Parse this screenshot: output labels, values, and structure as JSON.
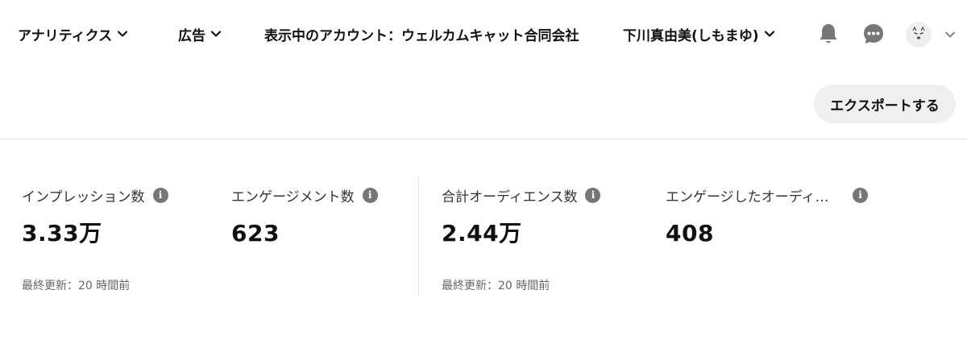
{
  "header": {
    "nav": [
      {
        "label": "アナリティクス"
      },
      {
        "label": "広告"
      }
    ],
    "account_prefix": "表示中のアカウント：",
    "account_name": "ウェルカムキャット合同会社",
    "user_name": "下川真由美(しもまゆ)"
  },
  "toolbar": {
    "export_label": "エクスポートする"
  },
  "metrics": [
    {
      "label": "インプレッション数",
      "value": "3.33万"
    },
    {
      "label": "エンゲージメント数",
      "value": "623"
    },
    {
      "label": "合計オーディエンス数",
      "value": "2.44万"
    },
    {
      "label": "エンゲージしたオーディ…",
      "value": "408"
    }
  ],
  "updated": [
    "最終更新：20 時間前",
    "最終更新：20 時間前"
  ],
  "icons": {
    "info": "info-icon",
    "bell": "bell-icon",
    "chat": "chat-icon",
    "chevron": "chevron-down-icon"
  },
  "colors": {
    "text": "#111111",
    "muted": "#666666",
    "icon": "#767676",
    "button_bg": "#efefef"
  }
}
